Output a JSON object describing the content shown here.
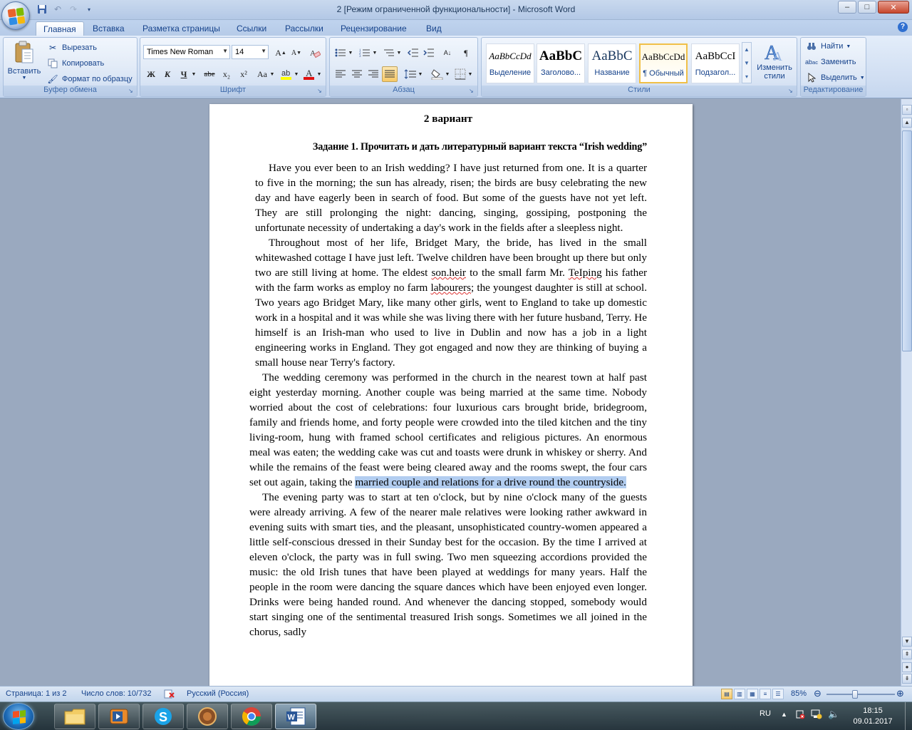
{
  "window": {
    "title": "2 [Режим ограниченной функциональности] - Microsoft Word",
    "controls": [
      "–",
      "□",
      "✕"
    ]
  },
  "tabs": [
    "Главная",
    "Вставка",
    "Разметка страницы",
    "Ссылки",
    "Рассылки",
    "Рецензирование",
    "Вид"
  ],
  "ribbon": {
    "clipboard": {
      "label": "Буфер обмена",
      "paste": "Вставить",
      "cut": "Вырезать",
      "copy": "Копировать",
      "format_painter": "Формат по образцу"
    },
    "font": {
      "label": "Шрифт",
      "font_name": "Times New Roman",
      "font_size": "14",
      "buttons": [
        "Ж",
        "К",
        "Ч",
        "abe",
        "x₂",
        "x²",
        "Aa"
      ]
    },
    "paragraph": {
      "label": "Абзац"
    },
    "styles": {
      "label": "Стили",
      "items": [
        {
          "sample": "AaBbCcDd",
          "name": "Выделение"
        },
        {
          "sample": "AaBbC",
          "name": "Заголово..."
        },
        {
          "sample": "AaBbC",
          "name": "Название"
        },
        {
          "sample": "AaBbCcDd",
          "name": "¶ Обычный"
        },
        {
          "sample": "AaBbCcI",
          "name": "Подзагол..."
        }
      ],
      "change_styles": "Изменить стили"
    },
    "editing": {
      "label": "Редактирование",
      "find": "Найти",
      "replace": "Заменить",
      "select": "Выделить"
    }
  },
  "document": {
    "heading": "2 вариант",
    "task": "Задание 1. Прочитать и дать литературный вариант текста “Irish wedding”",
    "p1": "Have you ever been to an Irish wedding? I have just returned from one. It is a quarter to five in the morning; the sun has already, risen; the birds are busy celebrating the new day and have eagerly been in search of food. But some of the guests have not yet left. They are still prolonging the night: dancing, singing, gossiping, postponing the unfortunate necessity of undertaking a day's work in the fields after a sleepless night.",
    "p2_a": "Throughout most of her life, Bridget Mary, the bride, has lived in the small whitewashed cottage I have just left. Twelve children have been brought up there but only two are still living at home. The eldest ",
    "p2_sq1": "son.heir",
    "p2_b": " to the small farm Mr. ",
    "p2_sq2": "TeIping",
    "p2_c": " his father with the farm works as employ no farm ",
    "p2_sq3": "labourers",
    "p2_d": "; the youngest daughter is still at school. Two years ago Bridget Mary, like many other girls, went to England to take up domestic work in a hospital and it was while she was living there with her future husband, Terry. He himself is an Irish-man who used to live in Dublin and now has a job in a light engineering works in England. They got engaged and now they are thinking of buying a small house near Terry's  factory.",
    "p3_a": "The wedding ceremony was performed in the church in the nearest town at half past eight yesterday morning. Another couple was being married at the same time. Nobody worried about the cost of celebrations: four luxurious cars brought bride, bridegroom, family and friends home, and forty people were crowded into the tiled kitchen and the tiny living-room, hung with framed school certificates and religious pictures. An enormous meal was eaten; the wedding cake was cut and toasts were drunk in whiskey or sherry. And while the remains of the feast were being cleared away and the rooms swept, the four cars set out again, taking the ",
    "p3_hl": "married couple and relations for a drive round the countryside.",
    "p4": "The evening party was to start at ten o'clock, but by nine o'clock many of the guests were already arriving. A few of the nearer male relatives were looking rather awkward in evening suits with smart ties, and the pleasant, unsophisticated country-women appeared a little self-conscious dressed in their Sunday best for the occasion. By the time I arrived at eleven o'clock, the party was in full swing. Two men squeezing accordions provided the music: the old Irish tunes that have been played at weddings for many years. Half the people in the room were dancing the square dances which have been enjoyed even longer. Drinks were being handed round. And whenever the dancing stopped, somebody would start singing one of the sentimental treasured Irish songs. Sometimes we all joined in the chorus, sadly"
  },
  "status": {
    "page": "Страница: 1 из 2",
    "words": "Число слов: 10/732",
    "language": "Русский (Россия)",
    "zoom": "85%",
    "zoom_level": 0.85
  },
  "taskbar": {
    "lang": "RU",
    "time": "18:15",
    "date": "09.01.2017",
    "apps": [
      "explorer",
      "media-player",
      "skype",
      "app-4",
      "chrome",
      "word"
    ]
  },
  "colors": {
    "accent": "#15428b",
    "selection": "#b2cdf0",
    "style_selected": "#f0c048"
  }
}
